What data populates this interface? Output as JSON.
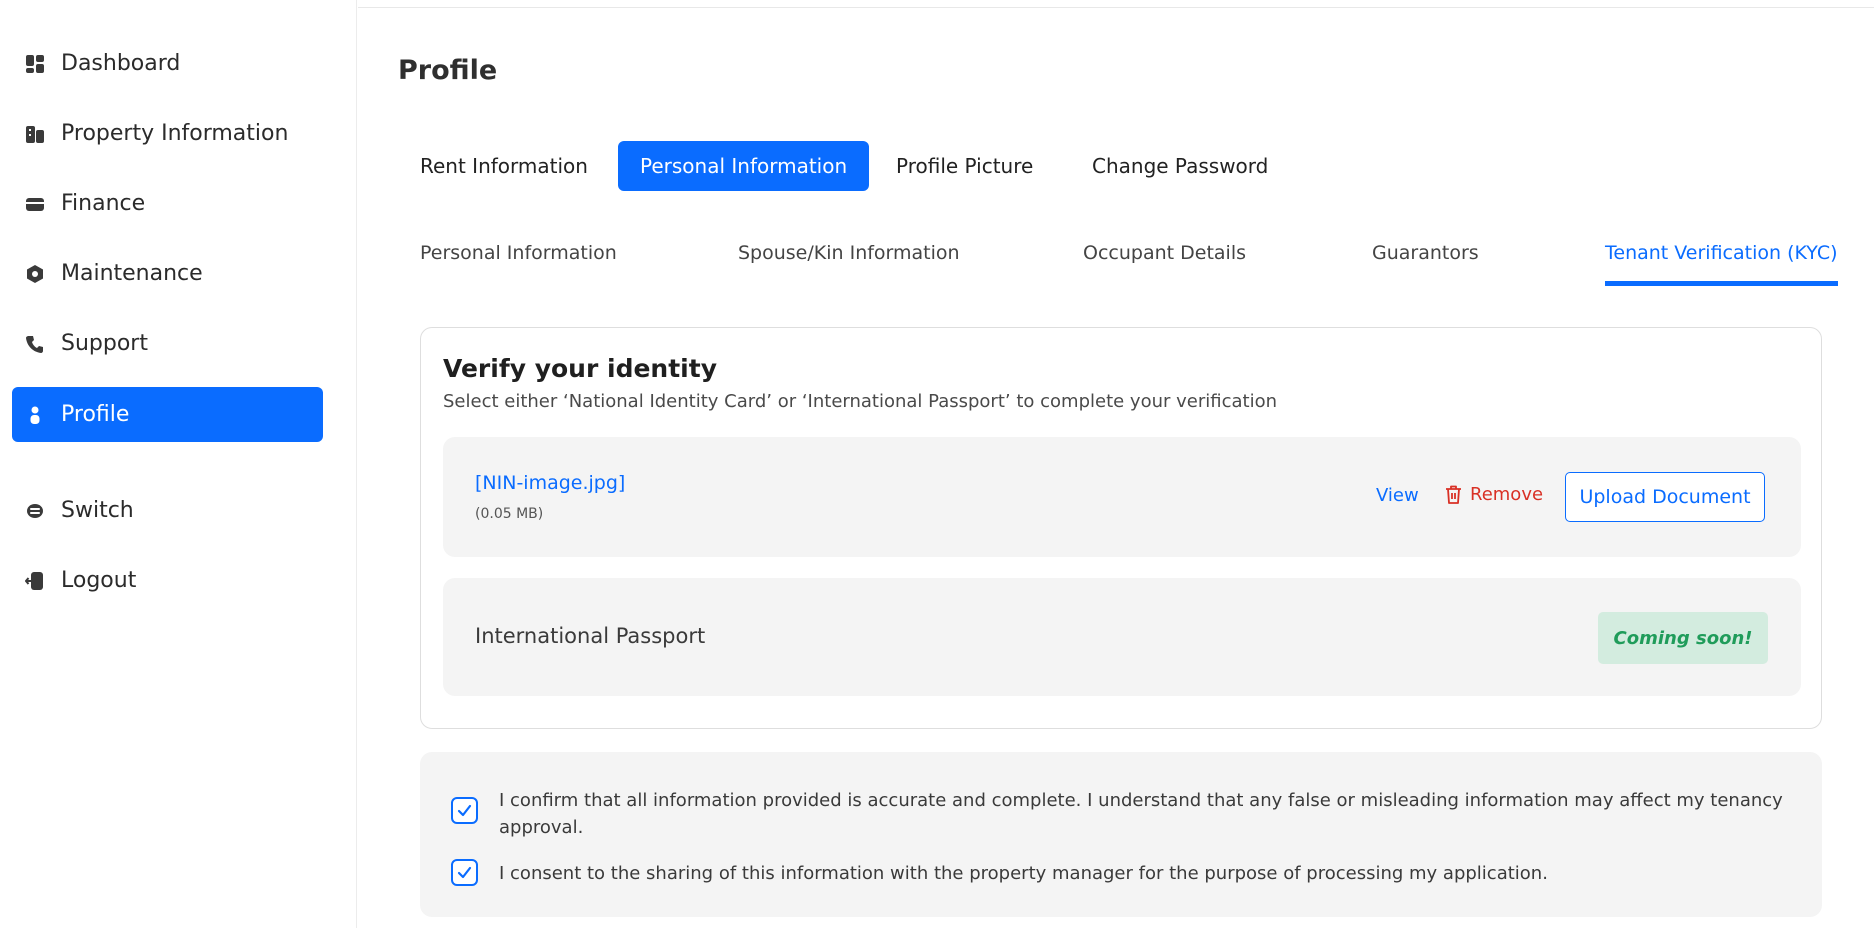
{
  "sidebar": {
    "items": [
      {
        "label": "Dashboard",
        "icon": "dashboard-icon"
      },
      {
        "label": "Property Information",
        "icon": "building-icon"
      },
      {
        "label": "Finance",
        "icon": "wallet-icon"
      },
      {
        "label": "Maintenance",
        "icon": "wrench-icon"
      },
      {
        "label": "Support",
        "icon": "phone-icon"
      },
      {
        "label": "Profile",
        "icon": "user-icon",
        "active": true
      },
      {
        "label": "Switch",
        "icon": "switch-icon"
      },
      {
        "label": "Logout",
        "icon": "logout-icon"
      }
    ]
  },
  "page": {
    "title": "Profile"
  },
  "main_tabs": [
    {
      "label": "Rent Information"
    },
    {
      "label": "Personal Information",
      "active": true
    },
    {
      "label": "Profile Picture"
    },
    {
      "label": "Change Password"
    }
  ],
  "sub_tabs": [
    {
      "label": "Personal Information"
    },
    {
      "label": "Spouse/Kin Information"
    },
    {
      "label": "Occupant Details"
    },
    {
      "label": "Guarantors"
    },
    {
      "label": "Tenant Verification (KYC)",
      "active": true
    }
  ],
  "verify": {
    "title": "Verify your identity",
    "subtitle": "Select either ‘National Identity Card’ or ‘International Passport’ to complete your verification",
    "document": {
      "file_name": "[NIN-image.jpg]",
      "file_size": "(0.05 MB)",
      "view_label": "View",
      "remove_label": "Remove",
      "upload_label": "Upload Document"
    },
    "passport": {
      "label": "International Passport",
      "badge": "Coming soon!"
    }
  },
  "consent": [
    {
      "text": "I confirm that all information provided is accurate and complete. I understand that any false or misleading information may affect my tenancy approval.",
      "checked": true
    },
    {
      "text": "I consent to the sharing of this information with the property manager for the purpose of processing my application.",
      "checked": true
    }
  ],
  "colors": {
    "accent": "#0a6cff",
    "danger": "#d93025",
    "success": "#1f9c5a",
    "success_bg": "#d3ecdf"
  }
}
